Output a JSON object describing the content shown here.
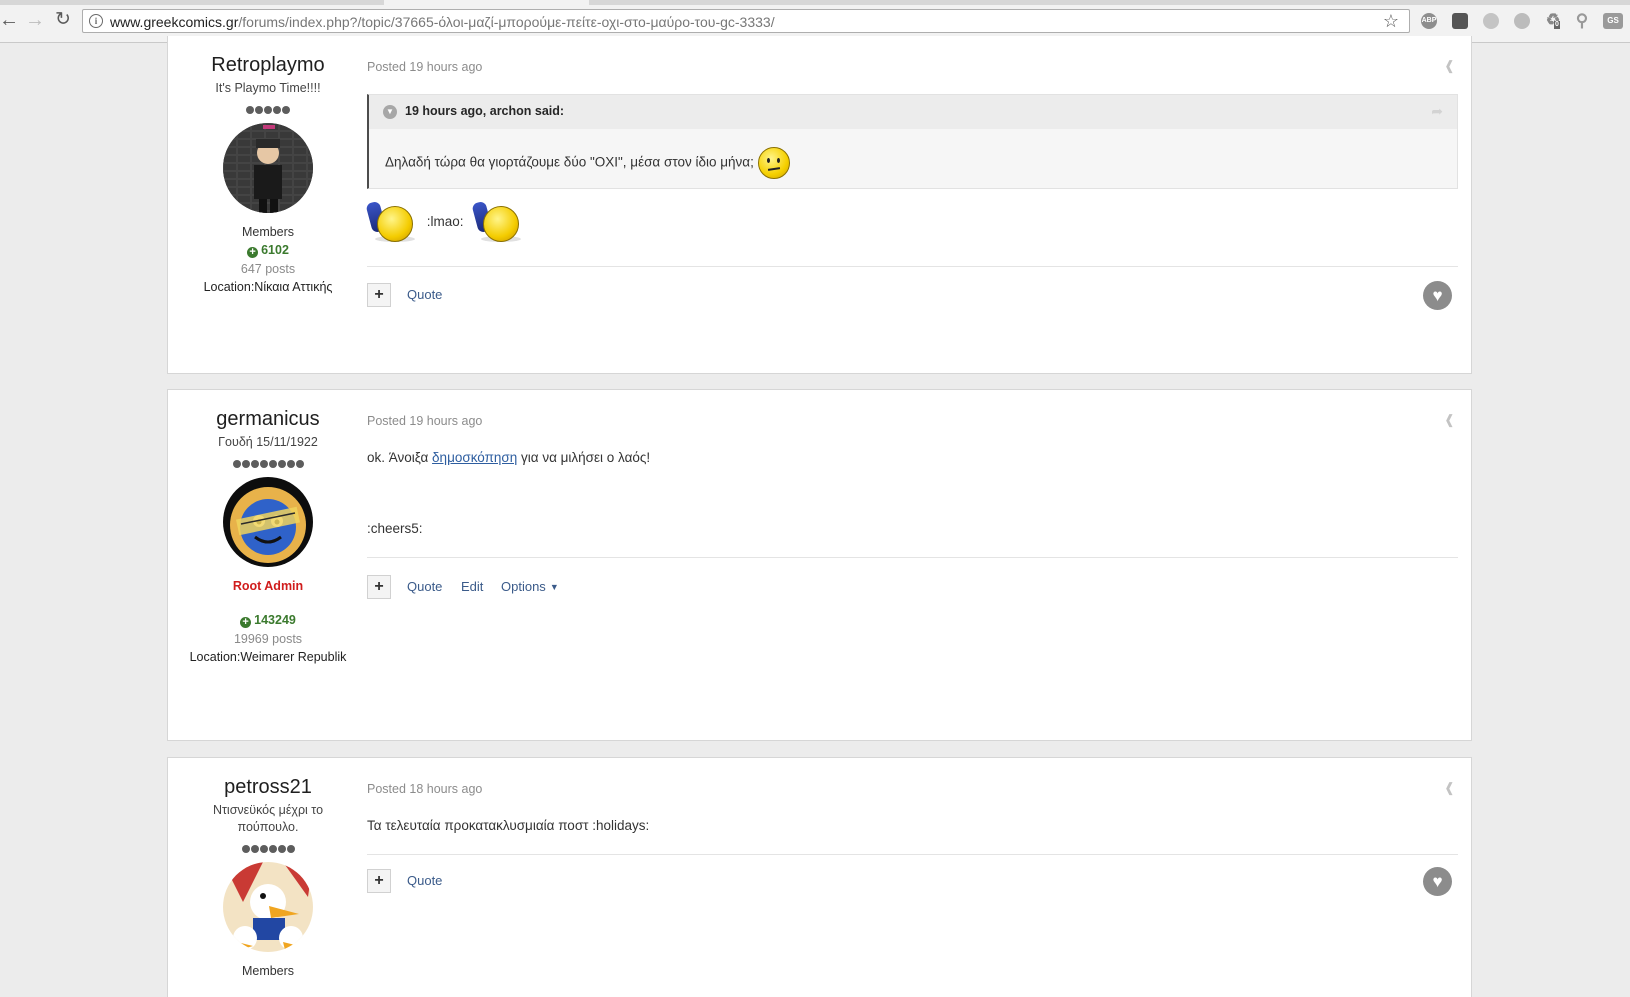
{
  "browser": {
    "url_host": "www.greekcomics.gr",
    "url_path": "/forums/index.php?/topic/37665-όλοι-μαζί-μπορούμε-πείτε-οχι-στο-μαύρο-του-gc-3333/",
    "extensions": [
      "ABP",
      "",
      "",
      "",
      "",
      "",
      "GS"
    ],
    "share_badge": "0"
  },
  "posts": [
    {
      "username": "Retroplaymo",
      "user_title": "It's Playmo Time!!!!",
      "pips": 5,
      "group": "Members",
      "reputation": "6102",
      "post_count": "647 posts",
      "location": "Location:Νίκαια Αττικής",
      "date": "Posted 19 hours ago",
      "quote": {
        "cite": "19 hours ago, archon said:",
        "text": "Δηλαδή τώρα θα γιορτάζουμε δύο \"ΟΧΙ\", μέσα στον ίδιο μήνα;"
      },
      "text": ":lmao:",
      "controls": {
        "quote": "Quote"
      }
    },
    {
      "username": "germanicus",
      "user_title": "Γουδή 15/11/1922",
      "pips": 8,
      "group": "Root Admin",
      "reputation": "143249",
      "post_count": "19969 posts",
      "location": "Location:Weimarer Republik",
      "date": "Posted 19 hours ago",
      "text_before": "ok. Άνοιξα",
      "text_link": "δημοσκόπηση",
      "text_after": "για να μιλήσει ο λαός!",
      "text_2": ":cheers5:",
      "controls": {
        "quote": "Quote",
        "edit": "Edit",
        "options": "Options"
      }
    },
    {
      "username": "petross21",
      "user_title": "Ντισνεϋκός μέχρι το πούπουλο.",
      "pips": 6,
      "group": "Members",
      "date": "Posted 18 hours ago",
      "text": "Τα τελευταία προκατακλυσμιαία ποστ  :holidays:",
      "controls": {
        "quote": "Quote"
      }
    }
  ],
  "colors": {
    "admin_group": "#d01c1c",
    "reputation": "#3b7a2e",
    "link": "#3b5b8a"
  }
}
